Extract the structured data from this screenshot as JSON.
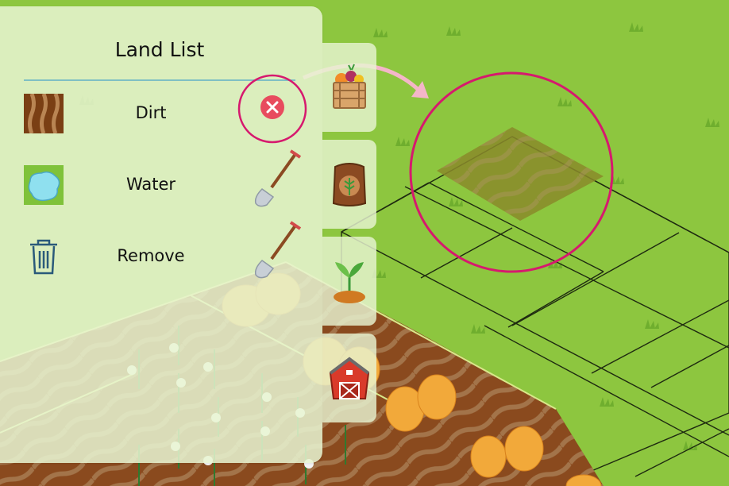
{
  "panel": {
    "title": "Land List",
    "items": [
      {
        "label": "Dirt",
        "thumb": "dirt-tile-icon",
        "action": "close-icon",
        "state": "selected"
      },
      {
        "label": "Water",
        "thumb": "water-tile-icon",
        "action": "shovel-icon",
        "state": "idle"
      },
      {
        "label": "Remove",
        "thumb": "trash-icon",
        "action": "shovel-icon",
        "state": "idle"
      }
    ]
  },
  "tabs": [
    {
      "icon": "crate-vegetables-icon"
    },
    {
      "icon": "seed-bag-icon"
    },
    {
      "icon": "sprout-icon"
    },
    {
      "icon": "barn-icon"
    }
  ],
  "colors": {
    "grass": "#8dc63f",
    "highlight_ring": "#d6196e",
    "close_button": "#e84b5e",
    "divider": "#7fc0c4",
    "placement_preview": "#8a8a2a",
    "arrow": "#f4b6c9"
  }
}
